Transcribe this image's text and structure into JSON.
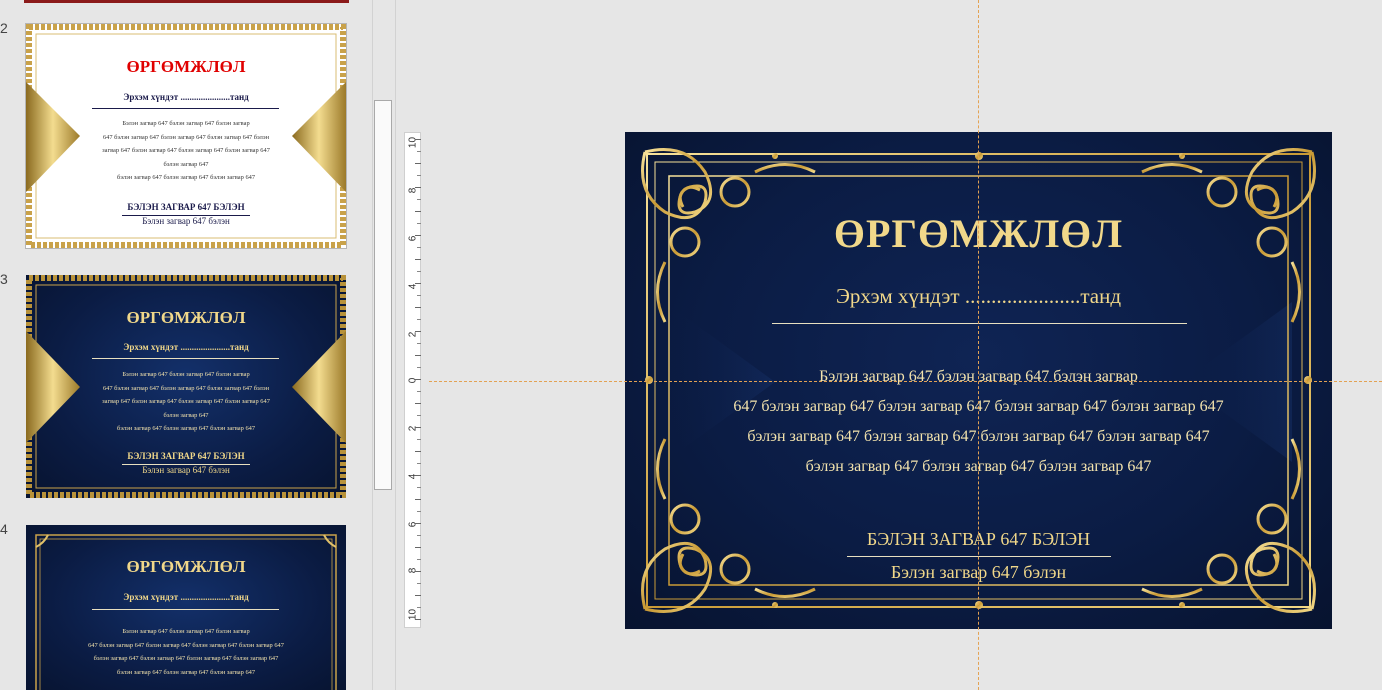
{
  "thumbnails": [
    {
      "number": "2",
      "title": "ӨРГӨМЖЛӨЛ",
      "greeting": "Эрхэм хүндэт ......................танд",
      "body": [
        "Бэлэн загвар 647 бэлэн загвар 647 бэлэн загвар",
        "647 бэлэн загвар 647 бэлэн загвар 647 бэлэн загвар 647 бэлэн",
        "загвар 647 бэлэн загвар 647 бэлэн загвар 647 бэлэн загвар 647",
        "бэлэн загвар 647",
        "бэлэн загвар 647 бэлэн загвар 647 бэлэн загвар 647"
      ],
      "sub1": "БЭЛЭН ЗАГВАР 647 БЭЛЭН",
      "sub2": "Бэлэн загвар 647 бэлэн"
    },
    {
      "number": "3",
      "title": "ӨРГӨМЖЛӨЛ",
      "greeting": "Эрхэм хүндэт ......................танд",
      "body": [
        "Бэлэн загвар 647 бэлэн загвар 647 бэлэн загвар",
        "647 бэлэн загвар 647 бэлэн загвар 647 бэлэн загвар 647 бэлэн",
        "загвар 647 бэлэн загвар 647 бэлэн загвар 647 бэлэн загвар 647",
        "бэлэн загвар 647",
        "бэлэн загвар 647 бэлэн загвар 647 бэлэн загвар 647"
      ],
      "sub1": "БЭЛЭН ЗАГВАР 647 БЭЛЭН",
      "sub2": "Бэлэн загвар 647 бэлэн"
    },
    {
      "number": "4",
      "title": "ӨРГӨМЖЛӨЛ",
      "greeting": "Эрхэм хүндэт ......................танд",
      "body": [
        "Бэлэн загвар 647 бэлэн загвар 647 бэлэн загвар",
        "647 бэлэн загвар 647 бэлэн загвар 647 бэлэн загвар 647 бэлэн загвар 647",
        "бэлэн загвар 647 бэлэн загвар 647 бэлэн загвар 647 бэлэн загвар 647",
        "бэлэн загвар 647 бэлэн загвар 647 бэлэн загвар 647"
      ]
    }
  ],
  "ruler": {
    "labels": [
      "10",
      "8",
      "6",
      "4",
      "2",
      "0",
      "2",
      "4",
      "6",
      "8",
      "10"
    ]
  },
  "slide": {
    "title": "ӨРГӨМЖЛӨЛ",
    "greeting": "Эрхэм хүндэт ......................танд",
    "body": [
      "Бэлэн загвар 647 бэлэн загвар 647 бэлэн загвар",
      "647 бэлэн загвар 647 бэлэн загвар 647 бэлэн загвар 647 бэлэн загвар 647",
      "бэлэн загвар 647 бэлэн загвар 647 бэлэн загвар 647 бэлэн загвар 647",
      "бэлэн загвар 647 бэлэн загвар 647 бэлэн загвар 647"
    ],
    "sub1": "БЭЛЭН ЗАГВАР 647 БЭЛЭН",
    "sub2": "Бэлэн загвар 647 бэлэн"
  },
  "colors": {
    "gold": "#f1d88a",
    "navy": "#0b1c44",
    "red_title": "#e00000",
    "dark_text": "#1a1a4a"
  }
}
